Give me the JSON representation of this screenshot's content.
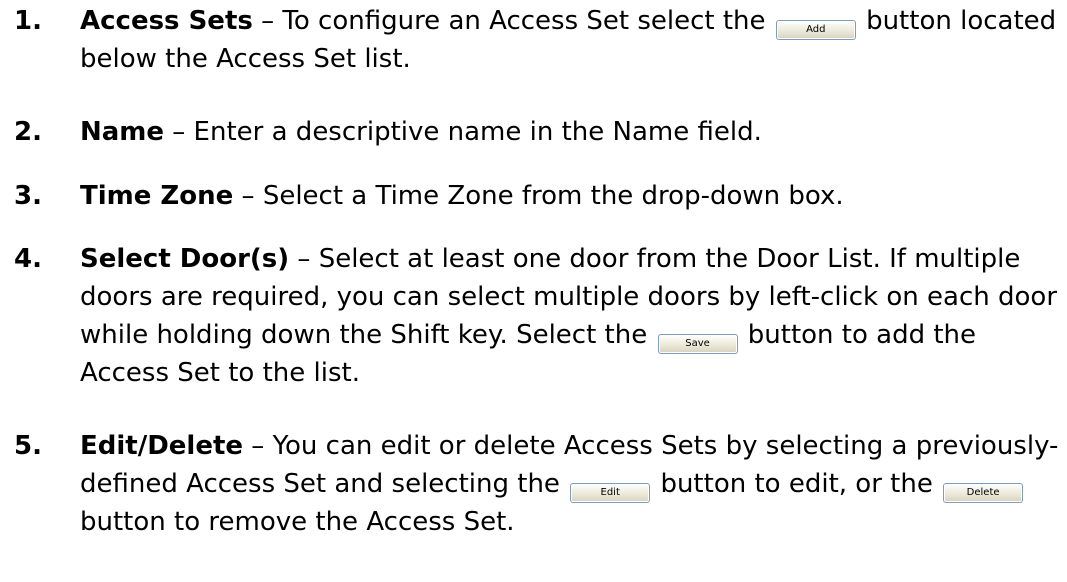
{
  "steps": [
    {
      "number": "1.",
      "term": "Access Sets",
      "text_a": " – To configure an Access Set select the ",
      "button": "Add",
      "text_b": " button located below the Access Set list."
    },
    {
      "number": "2.",
      "term": "Name",
      "text": " – Enter a descriptive name  in the Name field."
    },
    {
      "number": "3.",
      "term": "Time Zone",
      "text": " – Select a Time Zone from the drop-down box."
    },
    {
      "number": "4.",
      "term": "Select Door(s)",
      "text_a": " – Select at least one door from the Door List.  If multiple doors are required, you can select multiple doors by left-click on each door while holding down the Shift key.  Select the ",
      "button": "Save",
      "text_b": " button to add the Access Set to the list."
    },
    {
      "number": "5.",
      "term": "Edit/Delete",
      "text_a": " – You can edit or delete Access Sets by selecting a previously-defined Access Set and selecting the ",
      "button_a": "Edit",
      "text_b": " button to edit, or the ",
      "button_b": "Delete",
      "text_c": " button to remove the Access Set."
    }
  ]
}
